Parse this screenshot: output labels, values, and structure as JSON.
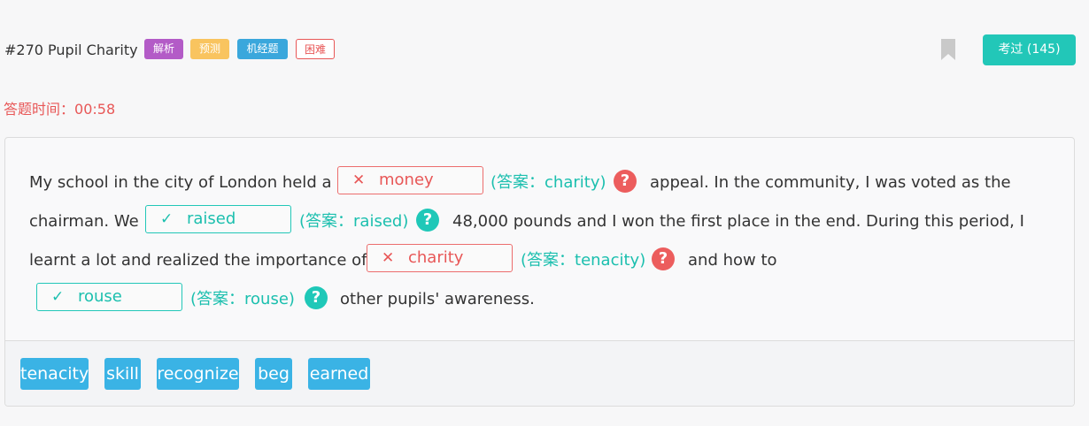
{
  "header": {
    "title": "#270 Pupil Charity",
    "tags": [
      "解析",
      "预测",
      "机经题",
      "困难"
    ],
    "pass_button": "考过 (145)"
  },
  "timer": {
    "label": "答题时间：",
    "value": "00:58"
  },
  "passage": {
    "line1_before": "My school in the city of London held a",
    "blank1": {
      "mark": "✕",
      "value": "money",
      "answer": "(答案：charity)",
      "status": "wrong"
    },
    "line1_after": "appeal. In the community, I was voted as the",
    "line2_before": "chairman. We",
    "blank2": {
      "mark": "✓",
      "value": "raised",
      "answer": "(答案：raised)",
      "status": "correct"
    },
    "line2_after": "48,000 pounds and I won the first place in the end. During this period, I",
    "line3_before": "learnt a lot and realized the importance of",
    "blank3": {
      "mark": "✕",
      "value": "charity",
      "answer": "(答案：tenacity)",
      "status": "wrong"
    },
    "line3_after": "and how to",
    "blank4": {
      "mark": "✓",
      "value": "rouse",
      "answer": "(答案：rouse)",
      "status": "correct"
    },
    "line4_after": "other pupils' awareness.",
    "help_glyph": "?"
  },
  "word_bank": [
    "tenacity",
    "skill",
    "recognize",
    "beg",
    "earned"
  ],
  "colors": {
    "wrong": "#e85757",
    "correct": "#1bbfae",
    "chip": "#3ab3e5",
    "pass_button": "#22c7b8"
  },
  "icons": [
    "bookmark-icon",
    "cross-icon",
    "check-icon",
    "help-icon"
  ]
}
